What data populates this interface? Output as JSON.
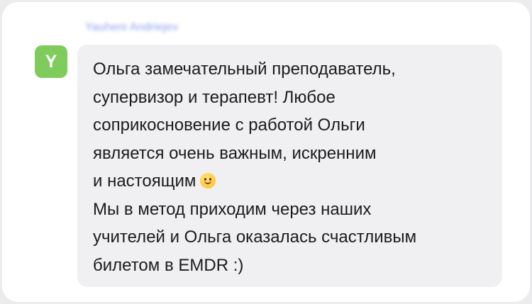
{
  "message": {
    "sender_name": "Yauheni Andriejev",
    "avatar_initial": "Y",
    "avatar_color": "#7fcc5c",
    "bubble_color": "#f0f0f2",
    "emoji_icon": "slightly-smiling-face-icon",
    "lines": [
      "Ольга замечательный преподаватель,",
      "супервизор и терапевт! Любое",
      "соприкосновение с работой Ольги",
      "является очень важным, искренним",
      "и настоящим",
      "Мы в метод приходим через наших",
      "учителей и Ольга оказалась счастливым",
      "билетом в EMDR :)"
    ]
  }
}
